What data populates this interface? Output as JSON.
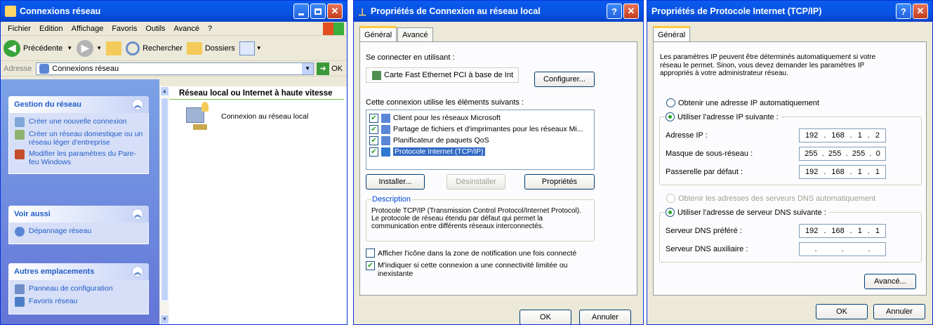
{
  "explorer": {
    "title": "Connexions réseau",
    "menu": [
      "Fichier",
      "Edition",
      "Affichage",
      "Favoris",
      "Outils",
      "Avancé",
      "?"
    ],
    "toolbar": {
      "back": "Précédente",
      "search": "Rechercher",
      "folders": "Dossiers"
    },
    "address_label": "Adresse",
    "address_value": "Connexions réseau",
    "go_label": "OK",
    "panels": [
      {
        "title": "Gestion du réseau",
        "items": [
          "Créer une nouvelle connexion",
          "Créer un réseau domestique ou un réseau léger d'entreprise",
          "Modifier les paramètres du Pare-feu Windows"
        ]
      },
      {
        "title": "Voir aussi",
        "items": [
          "Dépannage réseau"
        ]
      },
      {
        "title": "Autres emplacements",
        "items": [
          "Panneau de configuration",
          "Favoris réseau"
        ]
      }
    ],
    "section_title": "Réseau local ou Internet à haute vitesse",
    "connection_label": "Connexion au réseau local"
  },
  "lan": {
    "title": "Propriétés de Connexion au réseau local",
    "tabs": [
      "Général",
      "Avancé"
    ],
    "connect_label": "Se connecter en utilisant :",
    "adapter": "Carte Fast Ethernet PCI à base de Int",
    "configure": "Configurer...",
    "elements_label": "Cette connexion utilise les éléments suivants :",
    "elements": [
      "Client pour les réseaux Microsoft",
      "Partage de fichiers et d'imprimantes pour les réseaux Mi...",
      "Planificateur de paquets QoS",
      "Protocole Internet (TCP/IP)"
    ],
    "install": "Installer...",
    "uninstall": "Désinstaller",
    "properties": "Propriétés",
    "description_title": "Description",
    "description": "Protocole TCP/IP (Transmission Control Protocol/Internet Protocol). Le protocole de réseau étendu par défaut qui permet la communication entre différents réseaux interconnectés.",
    "notify": "Afficher l'icône dans la zone de notification une fois connecté",
    "warn": "M'indiquer si cette connexion a une connectivité limitée ou inexistante",
    "ok": "OK",
    "cancel": "Annuler"
  },
  "tcp": {
    "title": "Propriétés de Protocole Internet (TCP/IP)",
    "tab": "Général",
    "intro": "Les paramètres IP peuvent être déterminés automatiquement si votre réseau le permet. Sinon, vous devez demander les paramètres IP appropriés à votre administrateur réseau.",
    "auto_ip": "Obtenir une adresse IP automatiquement",
    "manual_ip": "Utiliser l'adresse IP suivante :",
    "ip_label": "Adresse IP :",
    "ip": [
      "192",
      "168",
      "1",
      "2"
    ],
    "mask_label": "Masque de sous-réseau :",
    "mask": [
      "255",
      "255",
      "255",
      "0"
    ],
    "gw_label": "Passerelle par défaut :",
    "gw": [
      "192",
      "168",
      "1",
      "1"
    ],
    "auto_dns": "Obtenir les adresses des serveurs DNS automatiquement",
    "manual_dns": "Utiliser l'adresse de serveur DNS suivante :",
    "dns1_label": "Serveur DNS préféré :",
    "dns1": [
      "192",
      "168",
      "1",
      "1"
    ],
    "dns2_label": "Serveur DNS auxiliaire :",
    "dns2": [
      ".",
      ".",
      "."
    ],
    "advanced": "Avancé...",
    "ok": "OK",
    "cancel": "Annuler"
  }
}
